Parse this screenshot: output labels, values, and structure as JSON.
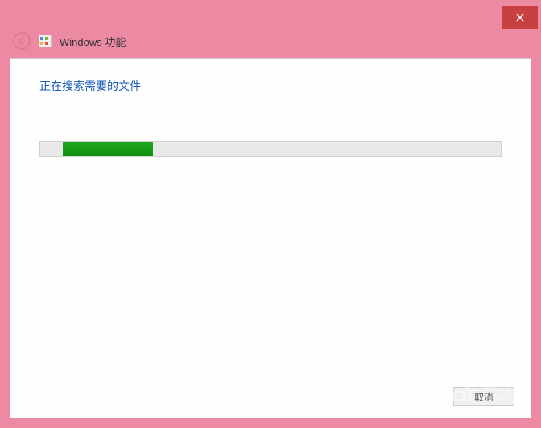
{
  "window": {
    "title": "Windows 功能"
  },
  "content": {
    "status_text": "正在搜索需要的文件",
    "progress_offset_percent": 4,
    "progress_width_percent": 18
  },
  "footer": {
    "cancel_label": "取消"
  },
  "watermark": {
    "text": "系统之家"
  }
}
